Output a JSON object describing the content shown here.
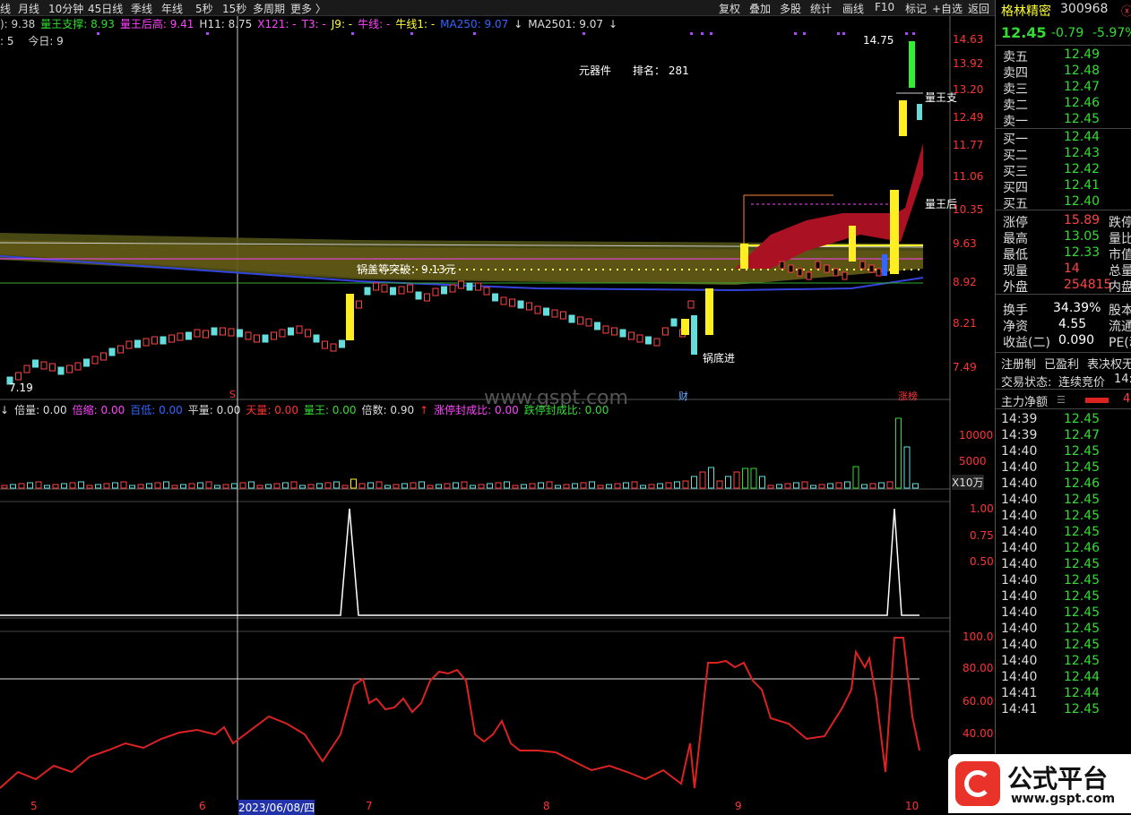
{
  "toolbar": {
    "left": [
      "线",
      "月线",
      "10分钟",
      "45日线",
      "季线",
      "年线",
      "5秒",
      "15秒",
      "多周期",
      "更多 〉"
    ],
    "right": [
      "复权",
      "叠加",
      "多股",
      "统计",
      "画线",
      "F10",
      "标记",
      "+自选",
      "返回"
    ]
  },
  "indicators_line": [
    {
      "text": "): 9.38",
      "color": "#cccccc"
    },
    {
      "text": "量王支撑: 8.93",
      "color": "#33dd33"
    },
    {
      "text": "量王后高: 9.41",
      "color": "#ff44ff"
    },
    {
      "text": "H11: 8.75",
      "color": "#dddddd"
    },
    {
      "text": "X121: -",
      "color": "#ff44ff"
    },
    {
      "text": "T3: -",
      "color": "#ff44ff"
    },
    {
      "text": "J9: -",
      "color": "#ffff33"
    },
    {
      "text": "牛线: -",
      "color": "#ff44ff"
    },
    {
      "text": "牛线1: -",
      "color": "#ffff33"
    },
    {
      "text": "MA250: 9.07",
      "color": "#3366ff"
    },
    {
      "text": "↓",
      "color": "#dddddd"
    },
    {
      "text": "MA2501: 9.07",
      "color": "#dddddd"
    },
    {
      "text": "↓",
      "color": "#dddddd"
    }
  ],
  "info_line": {
    "a": ": 5",
    "b": "今日: 9"
  },
  "annotations": {
    "component": "元器件",
    "rank": "排名： 281",
    "breakout": "锅盖等突破：9.13元",
    "bottom_entry": "锅底进",
    "high_label": "14.75",
    "low_label": "7.19",
    "liang_wang_1": "量王支",
    "liang_wang_2": "量王后",
    "watermark": "www.gspt.com",
    "marker_s": "S",
    "marker_cai": "财",
    "marker_zhang": "涨榜"
  },
  "price_axis": [
    "14.63",
    "13.92",
    "13.20",
    "12.49",
    "11.77",
    "11.06",
    "10.35",
    "9.63",
    "8.92",
    "8.21",
    "7.49"
  ],
  "volume_line": [
    {
      "text": "↓",
      "color": "#dddddd"
    },
    {
      "text": "倍量: 0.00",
      "color": "#dddddd"
    },
    {
      "text": "倍缩: 0.00",
      "color": "#ff44ff"
    },
    {
      "text": "百低: 0.00",
      "color": "#3366ff"
    },
    {
      "text": "平量: 0.00",
      "color": "#dddddd"
    },
    {
      "text": "天量: 0.00",
      "color": "#ff3333"
    },
    {
      "text": "量王: 0.00",
      "color": "#33dd33"
    },
    {
      "text": "倍数: 0.90",
      "color": "#dddddd"
    },
    {
      "text": "↑",
      "color": "#ff3333"
    },
    {
      "text": "涨停封成比: 0.00",
      "color": "#ff44ff"
    },
    {
      "text": "跌停封成比: 0.00",
      "color": "#33dd33"
    }
  ],
  "volume_axis": [
    "10000",
    "5000",
    "X10万"
  ],
  "pane3_axis": [
    "1.00",
    "0.75",
    "0.50"
  ],
  "pane4_axis": [
    "100.0",
    "80.00",
    "60.00",
    "40.00"
  ],
  "x_axis": [
    {
      "label": "5",
      "color": "#ff3333"
    },
    {
      "label": "6",
      "color": "#ff3333"
    },
    {
      "label": "2023/06/08/四",
      "color": "#ffffff"
    },
    {
      "label": "7",
      "color": "#ff3333"
    },
    {
      "label": "8",
      "color": "#ff3333"
    },
    {
      "label": "9",
      "color": "#ff3333"
    },
    {
      "label": "10",
      "color": "#ff3333"
    }
  ],
  "stock": {
    "name": "格林精密",
    "code": "300968",
    "price": "12.45",
    "change": "-0.79",
    "pct": "-5.97%"
  },
  "order_book": {
    "asks": [
      {
        "label": "卖五",
        "price": "12.49"
      },
      {
        "label": "卖四",
        "price": "12.48"
      },
      {
        "label": "卖三",
        "price": "12.47"
      },
      {
        "label": "卖二",
        "price": "12.46"
      },
      {
        "label": "卖一",
        "price": "12.45"
      }
    ],
    "bids": [
      {
        "label": "买一",
        "price": "12.44"
      },
      {
        "label": "买二",
        "price": "12.43"
      },
      {
        "label": "买三",
        "price": "12.42"
      },
      {
        "label": "买四",
        "price": "12.41"
      },
      {
        "label": "买五",
        "price": "12.40"
      }
    ]
  },
  "stats": [
    {
      "l": "涨停",
      "v": "15.89",
      "vc": "#ff4444",
      "c": "跌停"
    },
    {
      "l": "最高",
      "v": "13.05",
      "vc": "#33dd33",
      "c": "量比"
    },
    {
      "l": "最低",
      "v": "12.33",
      "vc": "#33dd33",
      "c": "市值"
    },
    {
      "l": "现量",
      "v": "14",
      "vc": "#ff4444",
      "c": "总量"
    },
    {
      "l": "外盘",
      "v": "254815",
      "vc": "#ff4444",
      "c": "内盘"
    }
  ],
  "stats2": [
    {
      "l": "换手",
      "v": "34.39%",
      "c": "股本"
    },
    {
      "l": "净资",
      "v": "4.55",
      "c": "流通"
    },
    {
      "l": "收益(二)",
      "v": "0.090",
      "c": "PE(动"
    }
  ],
  "reg": {
    "a": "注册制",
    "b": "已盈利",
    "c": "表决权无"
  },
  "trade_state": {
    "label": "交易状态:",
    "value": "连续竞价",
    "time": "14:4"
  },
  "flow": {
    "label": "主力净额",
    "value": "4"
  },
  "ticks": [
    {
      "t": "14:39",
      "p": "12.45"
    },
    {
      "t": "14:39",
      "p": "12.47"
    },
    {
      "t": "14:40",
      "p": "12.45"
    },
    {
      "t": "14:40",
      "p": "12.45"
    },
    {
      "t": "14:40",
      "p": "12.46"
    },
    {
      "t": "14:40",
      "p": "12.45"
    },
    {
      "t": "14:40",
      "p": "12.45"
    },
    {
      "t": "14:40",
      "p": "12.45"
    },
    {
      "t": "14:40",
      "p": "12.46"
    },
    {
      "t": "14:40",
      "p": "12.45"
    },
    {
      "t": "14:40",
      "p": "12.45"
    },
    {
      "t": "14:40",
      "p": "12.45"
    },
    {
      "t": "14:40",
      "p": "12.45"
    },
    {
      "t": "14:40",
      "p": "12.45"
    },
    {
      "t": "14:40",
      "p": "12.45"
    },
    {
      "t": "14:40",
      "p": "12.45"
    },
    {
      "t": "14:40",
      "p": "12.44"
    },
    {
      "t": "14:41",
      "p": "12.44"
    },
    {
      "t": "14:41",
      "p": "12.45"
    }
  ],
  "logo": {
    "text": "公式平台",
    "url": "www.gspt.com"
  }
}
